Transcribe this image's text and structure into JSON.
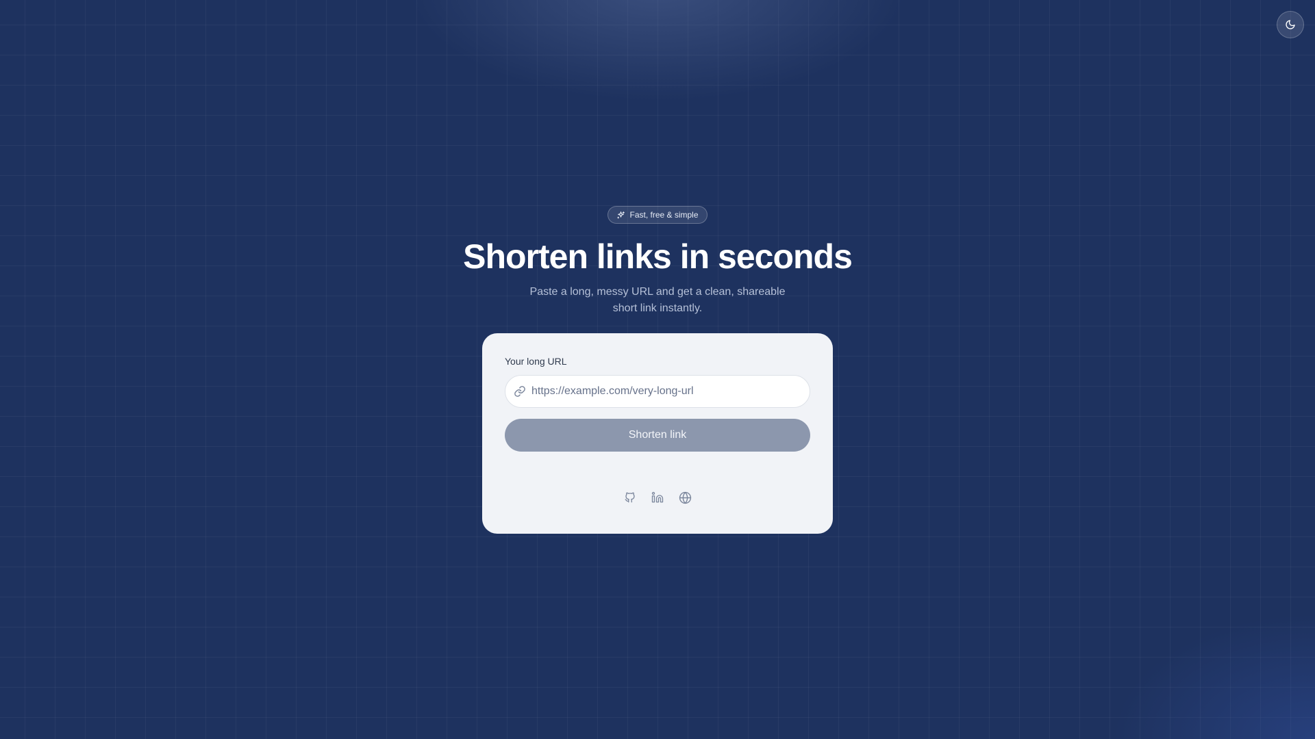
{
  "header": {
    "theme_toggle_icon": "moon-icon"
  },
  "hero": {
    "badge_icon": "sparkles-icon",
    "badge_label": "Fast, free & simple",
    "title": "Shorten links in seconds",
    "subtitle": "Paste a long, messy URL and get a clean, shareable short link instantly."
  },
  "form": {
    "url_label": "Your long URL",
    "url_value": "",
    "url_placeholder": "https://example.com/very-long-url",
    "url_icon": "link-icon",
    "submit_label": "Shorten link"
  },
  "socials": {
    "items": [
      "github-icon",
      "linkedin-icon",
      "globe-icon"
    ]
  },
  "colors": {
    "background": "#1e325f",
    "card": "#f1f3f7",
    "button_disabled": "#8c97ad"
  }
}
